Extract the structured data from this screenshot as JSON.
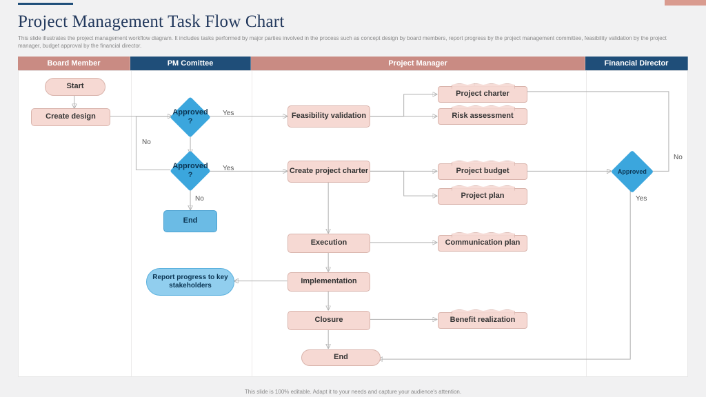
{
  "title": "Project Management Task Flow Chart",
  "subtitle": "This slide illustrates the project management workflow diagram. It includes tasks performed by major parties involved in the process such as concept design by board members, report progress by the project management committee, feasibility validation by the project manager, budget approval by the financial director.",
  "lanes": {
    "board_member": "Board Member",
    "pm_committee": "PM Comittee",
    "project_manager": "Project Manager",
    "financial_director": "Financial Director"
  },
  "nodes": {
    "start": "Start",
    "create_design": "Create design",
    "approved1": "Approved ?",
    "approved2": "Approved ?",
    "end1": "End",
    "feasibility": "Feasibility validation",
    "charter_task": "Project charter",
    "risk_task": "Risk assessment",
    "create_charter": "Create project charter",
    "project_budget": "Project budget",
    "project_plan": "Project plan",
    "approved3": "Approved",
    "execution": "Execution",
    "communication": "Communication plan",
    "implementation": "Implementation",
    "closure": "Closure",
    "benefit": "Benefit realization",
    "end2": "End",
    "report": "Report progress to key stakeholders"
  },
  "labels": {
    "yes1": "Yes",
    "no1": "No",
    "yes2": "Yes",
    "no2": "No",
    "yes3": "Yes",
    "no3": "No"
  },
  "footer": "This slide is 100% editable. Adapt it to your needs and capture your audience's attention."
}
